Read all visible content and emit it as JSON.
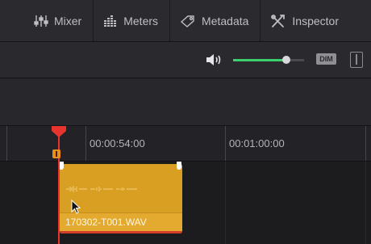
{
  "toolbar": {
    "items": [
      {
        "label": "Mixer",
        "icon": "mixer-icon"
      },
      {
        "label": "Meters",
        "icon": "meters-icon"
      },
      {
        "label": "Metadata",
        "icon": "metadata-tag-icon"
      },
      {
        "label": "Inspector",
        "icon": "inspector-tools-icon"
      }
    ]
  },
  "monitor": {
    "volume_level": 0.75,
    "dim_label": "DIM"
  },
  "ruler": {
    "timecodes": [
      "00:00:54:00",
      "00:01:00:00"
    ]
  },
  "clip": {
    "name": "170302-T001.WAV",
    "color": "#e3aa2f"
  },
  "colors": {
    "accent_green": "#3ccf6d",
    "playhead_red": "#e7342f",
    "marker_orange": "#e98d1f"
  }
}
